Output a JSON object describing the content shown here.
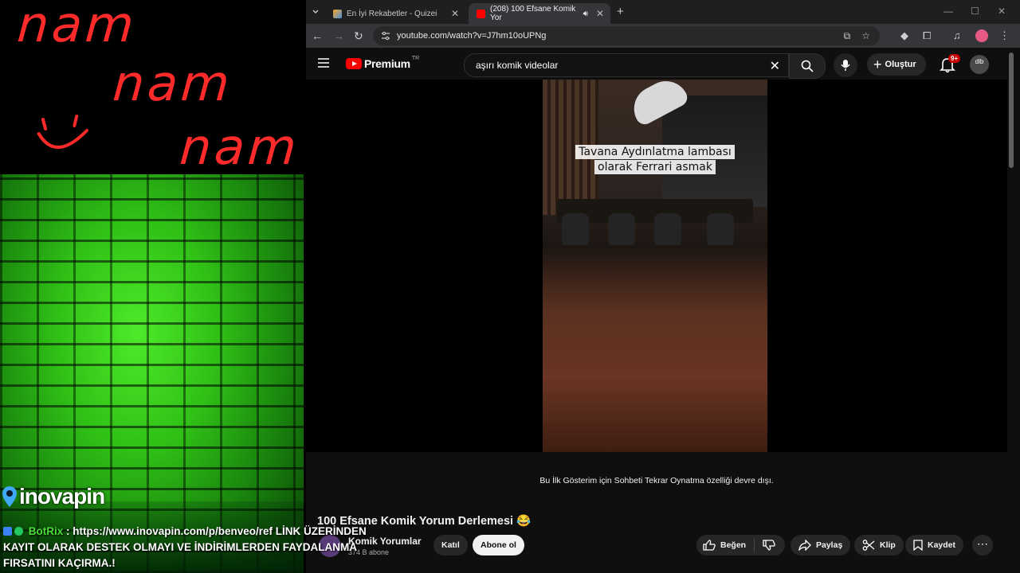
{
  "overlay": {
    "doodles": [
      "nam",
      "nam",
      "nam"
    ],
    "smiley": "◡̈",
    "logo_text": "inovapin",
    "chat": {
      "user": "BotRix",
      "message": ": https://www.inovapin.com/p/benveo/ref LİNK ÜZERİNDEN KAYIT OLARAK DESTEK OLMAYI VE İNDİRİMLERDEN FAYDALANMA FIRSATINI KAÇIRMA.!"
    }
  },
  "browser": {
    "tabs": [
      {
        "title": "En İyi Rekabetler - Quizei",
        "active": false
      },
      {
        "title": "(208) 100 Efsane Komik Yor",
        "active": true
      }
    ],
    "url": "youtube.com/watch?v=J7hm10oUPNg"
  },
  "youtube": {
    "logo": "Premium",
    "logo_region": "TR",
    "search_value": "aşırı komik videolar",
    "create_label": "Oluştur",
    "notifications": "9+",
    "avatar_text": "dlb",
    "caption_line1": "Tavana Aydınlatma lambası",
    "caption_line2": "olarak Ferrari asmak",
    "chat_disabled": "Bu İlk Gösterim için Sohbeti Tekrar Oynatma özelliği devre dışı.",
    "video_title": "100 Efsane Komik Yorum Derlemesi 😂",
    "channel_name": "Komik Yorumlar",
    "subscribers": "374 B abone",
    "join_label": "Katıl",
    "subscribe_label": "Abone ol",
    "like_label": "Beğen",
    "share_label": "Paylaş",
    "clip_label": "Klip",
    "save_label": "Kaydet"
  }
}
